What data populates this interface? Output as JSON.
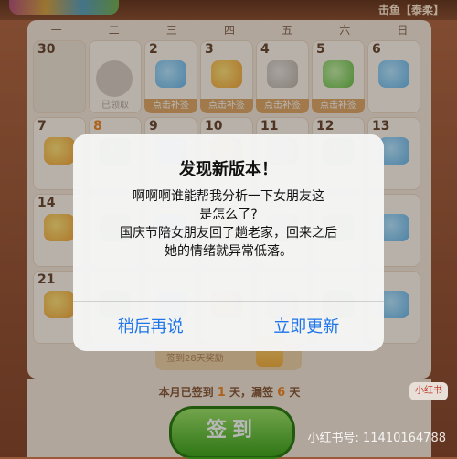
{
  "header": {
    "title": "击鱼【泰柔】"
  },
  "weekdays": [
    "一",
    "二",
    "三",
    "四",
    "五",
    "六",
    "日"
  ],
  "calendar": {
    "rows": [
      [
        {
          "n": "30",
          "tag": "",
          "state": "dim"
        },
        {
          "n": "",
          "tag": "已领取",
          "state": "claimed"
        },
        {
          "n": "2",
          "tag": "点击补签",
          "state": "normal"
        },
        {
          "n": "3",
          "tag": "点击补签",
          "state": "normal"
        },
        {
          "n": "4",
          "tag": "点击补签",
          "state": "normal"
        },
        {
          "n": "5",
          "tag": "点击补签",
          "state": "normal"
        },
        {
          "n": "6",
          "tag": "",
          "state": "normal"
        }
      ],
      [
        {
          "n": "7",
          "tag": "",
          "state": "normal"
        },
        {
          "n": "8",
          "tag": "",
          "state": "today"
        },
        {
          "n": "9",
          "tag": "",
          "state": "normal"
        },
        {
          "n": "10",
          "tag": "",
          "state": "normal"
        },
        {
          "n": "11",
          "tag": "",
          "state": "normal"
        },
        {
          "n": "12",
          "tag": "",
          "state": "normal"
        },
        {
          "n": "13",
          "tag": "",
          "state": "normal"
        }
      ],
      [
        {
          "n": "14",
          "tag": "",
          "state": "normal"
        },
        {
          "n": "",
          "tag": "",
          "state": "normal"
        },
        {
          "n": "",
          "tag": "",
          "state": "normal"
        },
        {
          "n": "",
          "tag": "",
          "state": "normal"
        },
        {
          "n": "",
          "tag": "",
          "state": "normal"
        },
        {
          "n": "",
          "tag": "",
          "state": "normal"
        },
        {
          "n": "",
          "tag": "",
          "state": "normal"
        }
      ],
      [
        {
          "n": "21",
          "tag": "",
          "state": "normal"
        },
        {
          "n": "",
          "tag": "",
          "state": "normal"
        },
        {
          "n": "",
          "tag": "",
          "state": "normal"
        },
        {
          "n": "",
          "tag": "",
          "state": "normal"
        },
        {
          "n": "",
          "tag": "",
          "state": "normal"
        },
        {
          "n": "",
          "tag": "",
          "state": "normal"
        },
        {
          "n": "",
          "tag": "",
          "state": "normal"
        }
      ]
    ]
  },
  "reward": {
    "text": "签到28天奖励"
  },
  "streak": {
    "prefix": "本月已签到 ",
    "signed": "1",
    "mid": " 天，漏签 ",
    "missed": "6",
    "suffix": " 天"
  },
  "sign_button": {
    "label": "签到"
  },
  "dialog": {
    "title": "发现新版本！",
    "message_lines": [
      "啊啊啊谁能帮我分析一下女朋友这",
      "是怎么了?",
      "国庆节陪女朋友回了趟老家，回来之后",
      "她的情绪就异常低落。"
    ],
    "later_label": "稍后再说",
    "update_label": "立即更新"
  },
  "watermark": {
    "logo": "小红书",
    "text": "小红书号: 11410164788"
  }
}
